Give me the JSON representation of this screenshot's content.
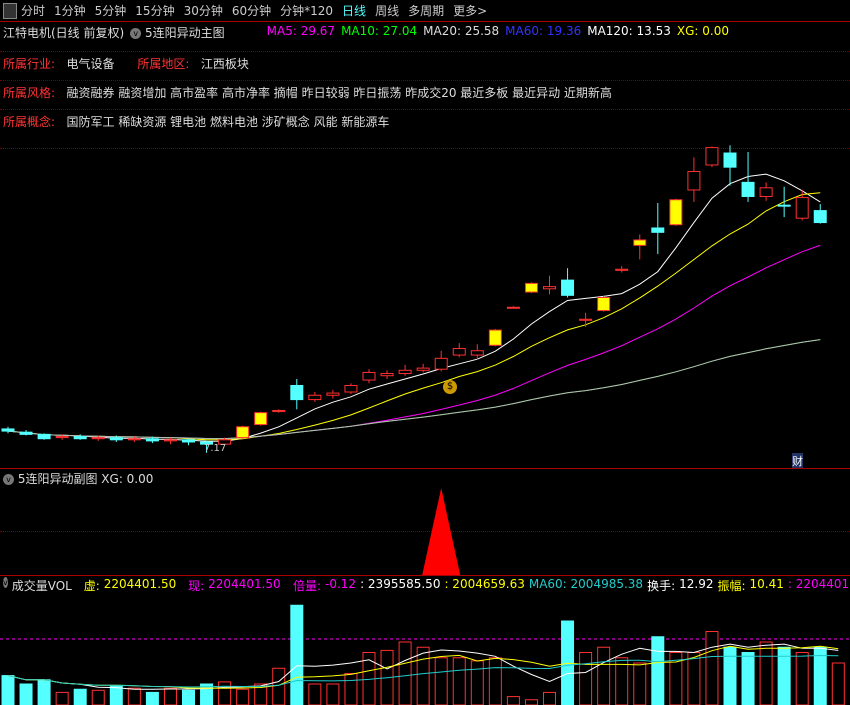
{
  "toolbar": {
    "tabs": [
      "分时",
      "1分钟",
      "5分钟",
      "15分钟",
      "30分钟",
      "60分钟",
      "分钟*120",
      "日线",
      "周线",
      "多周期",
      "更多>"
    ],
    "active": "日线"
  },
  "header": {
    "stock": "江特电机(日线 前复权)",
    "indicator": "5连阳异动主图",
    "ma5": "MA5: 29.67",
    "ma10": "MA10: 27.04",
    "ma20": "MA20: 25.58",
    "ma60": "MA60: 19.36",
    "ma120": "MA120: 13.53",
    "xg": "XG: 0.00"
  },
  "info": {
    "industry_label": "所属行业:",
    "industry": "电气设备",
    "region_label": "所属地区:",
    "region": "江西板块",
    "style_label": "所属风格:",
    "style": "融资融券 融资增加 高市盈率 高市净率 摘帽 昨日较弱 昨日振荡 昨成交20 最近多板 最近异动 近期新高",
    "concept_label": "所属概念:",
    "concept": "国防军工 稀缺资源 锂电池 燃料电池 涉矿概念 风能 新能源车"
  },
  "markers": {
    "low": "7.17",
    "fin": "财",
    "money": "$"
  },
  "sub": {
    "title": "5连阳异动副图",
    "xg": "XG: 0.00"
  },
  "vol": {
    "title": "成交量VOL",
    "xu_label": "虚:",
    "xu": "2204401.50",
    "xian_label": "现:",
    "xian": "2204401.50",
    "bei_label": "倍量:",
    "bei": "-0.12",
    "m1": ": 2395585.50",
    "m2": ": 2004659.63",
    "ma60": "MA60: 2004985.38",
    "hs_label": "换手:",
    "hs": "12.92",
    "zf_label": "振幅:",
    "zf": "10.41",
    "tail": ": 2204401."
  },
  "colors": {
    "up": "#ff3030",
    "down": "#54ffff",
    "fill": "#ffff00",
    "ma5": "#ffffff",
    "ma10": "#ffff00",
    "ma20": "#ff00ff",
    "ma60": "#00cc00",
    "ma120": "#bbbbbb"
  },
  "chart_data": {
    "type": "candlestick",
    "ylim": [
      7,
      36
    ],
    "candles": [
      [
        9.4,
        9.2,
        9.6,
        9.0,
        "down"
      ],
      [
        9.1,
        8.9,
        9.3,
        8.8,
        "down"
      ],
      [
        8.9,
        8.5,
        9.0,
        8.4,
        "down"
      ],
      [
        8.6,
        8.7,
        8.9,
        8.4,
        "up"
      ],
      [
        8.7,
        8.5,
        8.9,
        8.4,
        "down"
      ],
      [
        8.5,
        8.6,
        8.8,
        8.3,
        "up"
      ],
      [
        8.6,
        8.4,
        8.8,
        8.2,
        "down"
      ],
      [
        8.4,
        8.5,
        8.7,
        8.2,
        "up"
      ],
      [
        8.5,
        8.3,
        8.7,
        8.1,
        "down"
      ],
      [
        8.3,
        8.4,
        8.6,
        8.0,
        "up"
      ],
      [
        8.4,
        8.2,
        8.5,
        7.9,
        "down"
      ],
      [
        8.2,
        8.0,
        8.3,
        7.2,
        "down"
      ],
      [
        8.0,
        8.4,
        8.6,
        7.9,
        "up"
      ],
      [
        8.6,
        9.6,
        9.7,
        8.5,
        "upfill"
      ],
      [
        9.8,
        10.9,
        11.0,
        9.7,
        "upfill"
      ],
      [
        11.0,
        11.1,
        11.2,
        10.9,
        "up"
      ],
      [
        13.4,
        12.1,
        14.0,
        11.2,
        "down"
      ],
      [
        12.1,
        12.5,
        12.8,
        11.9,
        "up"
      ],
      [
        12.5,
        12.7,
        13.0,
        12.2,
        "up"
      ],
      [
        12.8,
        13.4,
        13.6,
        12.6,
        "up"
      ],
      [
        13.9,
        14.6,
        14.9,
        13.6,
        "up"
      ],
      [
        14.3,
        14.5,
        14.8,
        14.0,
        "up"
      ],
      [
        14.5,
        14.8,
        15.3,
        14.3,
        "up"
      ],
      [
        14.8,
        15.0,
        15.4,
        14.6,
        "up"
      ],
      [
        14.9,
        15.9,
        16.6,
        14.7,
        "up"
      ],
      [
        16.2,
        16.8,
        17.3,
        16.0,
        "up"
      ],
      [
        16.2,
        16.6,
        17.2,
        15.8,
        "up"
      ],
      [
        17.1,
        18.5,
        18.6,
        17.0,
        "upfill"
      ],
      [
        20.6,
        20.6,
        20.7,
        20.5,
        "up"
      ],
      [
        22.0,
        22.8,
        22.9,
        21.9,
        "upfill"
      ],
      [
        22.3,
        22.5,
        23.5,
        21.8,
        "up"
      ],
      [
        23.1,
        21.7,
        24.2,
        21.5,
        "down"
      ],
      [
        19.4,
        19.5,
        20.1,
        18.8,
        "up"
      ],
      [
        20.3,
        21.5,
        21.7,
        20.2,
        "upfill"
      ],
      [
        24.0,
        24.1,
        24.4,
        23.8,
        "up"
      ],
      [
        26.3,
        26.8,
        27.3,
        25.0,
        "upfill"
      ],
      [
        27.9,
        27.5,
        30.2,
        25.5,
        "down"
      ],
      [
        28.2,
        30.5,
        30.6,
        28.1,
        "upfill"
      ],
      [
        31.4,
        33.1,
        34.4,
        30.3,
        "up"
      ],
      [
        33.7,
        35.3,
        35.4,
        33.5,
        "up"
      ],
      [
        34.8,
        33.5,
        35.5,
        31.8,
        "down"
      ],
      [
        32.1,
        30.8,
        34.9,
        30.3,
        "down"
      ],
      [
        30.8,
        31.6,
        32.1,
        30.4,
        "up"
      ],
      [
        30.0,
        30.0,
        31.7,
        28.9,
        "down"
      ],
      [
        28.8,
        30.7,
        31.4,
        28.6,
        "up"
      ],
      [
        29.5,
        28.4,
        30.1,
        28.3,
        "down"
      ]
    ],
    "volume": {
      "ylim": [
        0,
        100
      ],
      "values": [
        28,
        20,
        24,
        12,
        15,
        14,
        18,
        16,
        12,
        16,
        14,
        20,
        22,
        15,
        20,
        35,
        95,
        20,
        20,
        30,
        50,
        52,
        60,
        55,
        45,
        45,
        42,
        45,
        8,
        5,
        12,
        80,
        50,
        55,
        45,
        40,
        65,
        50,
        50,
        70,
        55,
        50,
        60,
        55,
        50,
        55,
        40
      ]
    }
  },
  "sub_chart": {
    "signal_bar_index": 24,
    "value": 1
  }
}
